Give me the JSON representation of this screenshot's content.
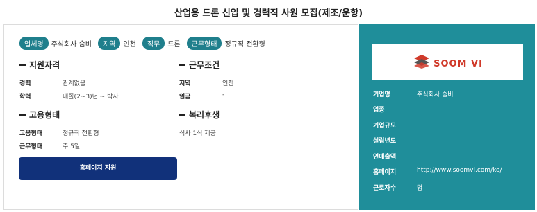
{
  "title": "산업용 드론 신입 및 경력직 사원 모집(제조/운항)",
  "tags": [
    {
      "label": "업체명",
      "value": "주식회사 숨비"
    },
    {
      "label": "지역",
      "value": "인천"
    },
    {
      "label": "직무",
      "value": "드론"
    },
    {
      "label": "근무형태",
      "value": "정규직 전환형"
    }
  ],
  "sections": {
    "qualification": {
      "title": "지원자격",
      "rows": [
        {
          "label": "경력",
          "value": "관계없음"
        },
        {
          "label": "학력",
          "value": "대졸(2~3)년 ~ 박사"
        }
      ]
    },
    "conditions": {
      "title": "근무조건",
      "rows": [
        {
          "label": "지역",
          "value": "인천"
        },
        {
          "label": "임금",
          "value": "-"
        }
      ]
    },
    "employment": {
      "title": "고용형태",
      "rows": [
        {
          "label": "고용형태",
          "value": "정규직 전환형"
        },
        {
          "label": "근무형태",
          "value": "주 5일"
        }
      ]
    },
    "benefits": {
      "title": "복리후생",
      "text": "식사 1식 제공"
    }
  },
  "apply_button": "홈페이지 지원",
  "company": {
    "logo_text": "SOOM VI",
    "rows": [
      {
        "label": "기업명",
        "value": "주식회사 숨비"
      },
      {
        "label": "업종",
        "value": ""
      },
      {
        "label": "기업규모",
        "value": ""
      },
      {
        "label": "설립년도",
        "value": ""
      },
      {
        "label": "연매출액",
        "value": ""
      },
      {
        "label": "홈페이지",
        "value": "http://www.soomvi.com/ko/"
      },
      {
        "label": "근로자수",
        "value": "명"
      }
    ]
  },
  "colors": {
    "tag_bg": "#1f7f8c",
    "side_panel": "#1f8e9a",
    "apply_button": "#11317a",
    "logo_red": "#d03a2a"
  }
}
